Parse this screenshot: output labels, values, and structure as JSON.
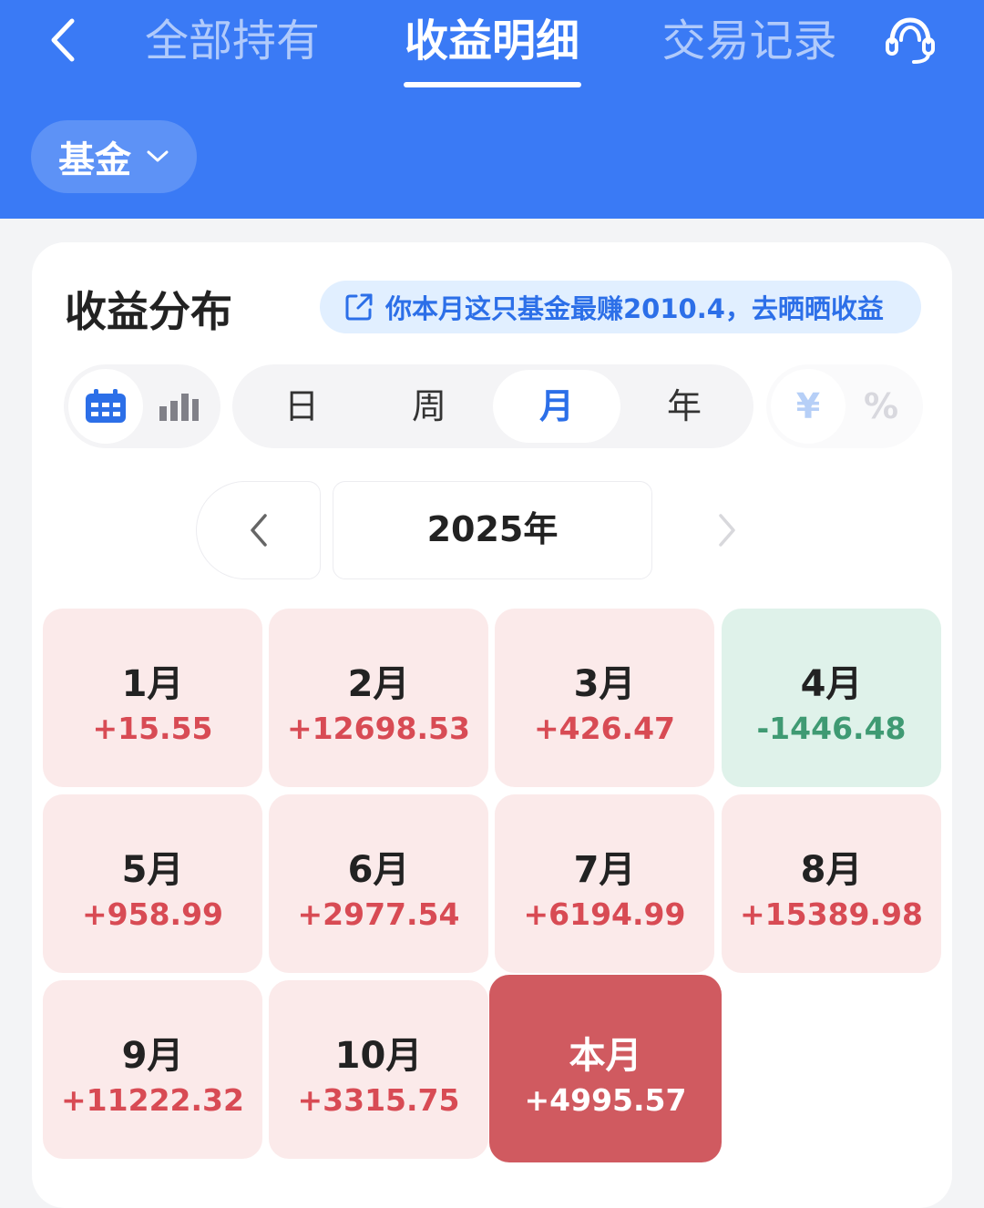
{
  "header": {
    "tabs": [
      {
        "label": "全部持有",
        "active": false
      },
      {
        "label": "收益明细",
        "active": true
      },
      {
        "label": "交易记录",
        "active": false
      }
    ],
    "back_icon": "chevron-left-icon",
    "service_icon": "customer-service-headset-icon"
  },
  "filter": {
    "label": "基金",
    "icon": "chevron-down-icon"
  },
  "card": {
    "title": "收益分布",
    "share_text": "你本月这只基金最赚2010.4，去晒晒收益",
    "share_icon": "share-external-icon"
  },
  "view_toggle": {
    "options": [
      "calendar-icon",
      "bar-chart-icon"
    ],
    "selected": 0
  },
  "period": {
    "options": [
      "日",
      "周",
      "月",
      "年"
    ],
    "selected": "月"
  },
  "unit": {
    "options": [
      "¥",
      "%"
    ],
    "selected": "¥"
  },
  "year_nav": {
    "current": "2025年"
  },
  "months": [
    {
      "label": "1月",
      "value": "+15.55",
      "type": "gain"
    },
    {
      "label": "2月",
      "value": "+12698.53",
      "type": "gain"
    },
    {
      "label": "3月",
      "value": "+426.47",
      "type": "gain"
    },
    {
      "label": "4月",
      "value": "-1446.48",
      "type": "loss"
    },
    {
      "label": "5月",
      "value": "+958.99",
      "type": "gain"
    },
    {
      "label": "6月",
      "value": "+2977.54",
      "type": "gain"
    },
    {
      "label": "7月",
      "value": "+6194.99",
      "type": "gain"
    },
    {
      "label": "8月",
      "value": "+15389.98",
      "type": "gain"
    },
    {
      "label": "9月",
      "value": "+11222.32",
      "type": "gain"
    },
    {
      "label": "10月",
      "value": "+3315.75",
      "type": "gain"
    },
    {
      "label": "本月",
      "value": "+4995.57",
      "type": "current"
    }
  ],
  "colors": {
    "header_blue": "#3a7af5",
    "gain_red": "#d84b54",
    "loss_green": "#3f9a73",
    "gain_tile": "#fbeaea",
    "loss_tile": "#dff2ea",
    "current_tile": "#d05a60",
    "accent_blue": "#2c6fe8"
  }
}
